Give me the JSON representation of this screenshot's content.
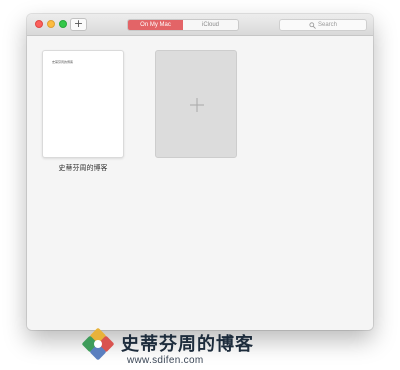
{
  "toolbar": {
    "add_label": "+",
    "tabs": [
      {
        "label": "On My Mac",
        "active": true
      },
      {
        "label": "iCloud",
        "active": false
      }
    ],
    "search_placeholder": "Search",
    "accent_color": "#e36467"
  },
  "documents": [
    {
      "name": "史蒂芬周的博客",
      "preview_text": "史蒂芬周的博客"
    }
  ],
  "watermark": {
    "title": "史蒂芬周的博客",
    "url": "www.sdifen.com"
  }
}
